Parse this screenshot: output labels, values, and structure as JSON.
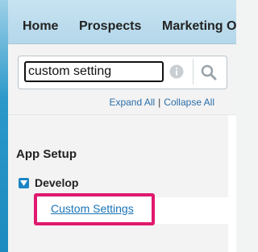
{
  "tabs": [
    {
      "label": "Home"
    },
    {
      "label": "Prospects"
    },
    {
      "label": "Marketing O"
    }
  ],
  "search": {
    "value": "custom setting",
    "info_icon": "info-icon",
    "search_icon": "search-icon"
  },
  "links": {
    "expand_all": "Expand All",
    "separator": "|",
    "collapse_all": "Collapse All"
  },
  "nav": {
    "section_title": "App Setup",
    "tree_item": {
      "label": "Develop",
      "expanded": true,
      "toggle_icon": "collapse-triangle-icon"
    },
    "sub_item": {
      "label": "Custom Settings"
    }
  },
  "colors": {
    "tab_bar": "#b4d7ea",
    "accent_stripe": "#1d8bbf",
    "link": "#1a74b8",
    "highlight": "#e0196e",
    "tree_toggle": "#1b84c4"
  }
}
